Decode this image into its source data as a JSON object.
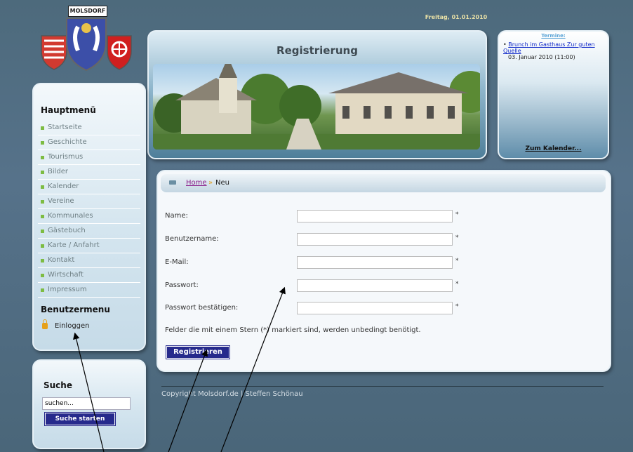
{
  "logo": {
    "ribbon": "MOLSDORF"
  },
  "date": "Freitag, 01.01.2010",
  "header": {
    "title": "Registrierung"
  },
  "termine": {
    "title": "Termine:",
    "event_link": "Brunch im Gasthaus Zur guten Quelle",
    "event_date": "03. Januar 2010 (11:00)",
    "calendar_link": "Zum Kalender..."
  },
  "menu": {
    "title": "Hauptmenü",
    "items": [
      {
        "label": "Startseite"
      },
      {
        "label": "Geschichte"
      },
      {
        "label": "Tourismus"
      },
      {
        "label": "Bilder"
      },
      {
        "label": "Kalender"
      },
      {
        "label": "Vereine"
      },
      {
        "label": "Kommunales"
      },
      {
        "label": "Gästebuch"
      },
      {
        "label": "Karte / Anfahrt"
      },
      {
        "label": "Kontakt"
      },
      {
        "label": "Wirtschaft"
      },
      {
        "label": "Impressum"
      }
    ],
    "user_title": "Benutzermenu",
    "login_label": "Einloggen"
  },
  "search": {
    "title": "Suche",
    "value": "suchen...",
    "button": "Suche starten"
  },
  "breadcrumb": {
    "home": "Home",
    "separator": "»",
    "current": "Neu"
  },
  "form": {
    "name_label": "Name:",
    "username_label": "Benutzername:",
    "email_label": "E-Mail:",
    "password_label": "Passwort:",
    "confirm_label": "Passwort bestätigen:",
    "required_marker": "*",
    "note": "Felder die mit einem Stern (*) markiert sind, werden unbedingt benötigt.",
    "submit": "Registrieren"
  },
  "footer": {
    "copyright": "Copyright Molsdorf.de | Steffen Schönau"
  }
}
